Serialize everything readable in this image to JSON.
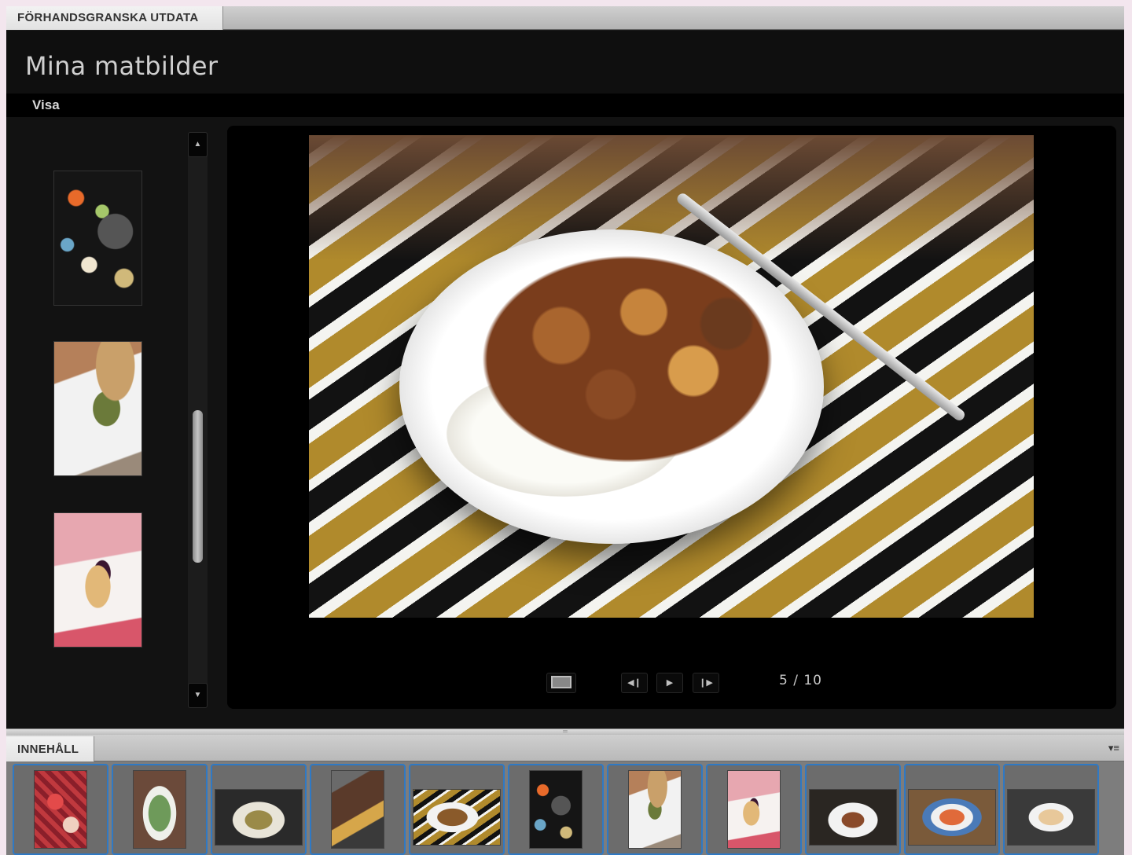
{
  "preview_tab": {
    "label": "FÖRHANDSGRANSKA UTDATA"
  },
  "gallery": {
    "title": "Mina matbilder",
    "view_label": "Visa"
  },
  "filmstrip": {
    "scroll_up_glyph": "▲",
    "scroll_down_glyph": "▼"
  },
  "viewer": {
    "counter": "5 / 10",
    "prev_glyph": "◀❙",
    "play_glyph": "▶",
    "next_glyph": "❙▶"
  },
  "content_panel": {
    "tab_label": "INNEHÅLL",
    "menu_glyph": "▾≡"
  },
  "resize_grip_glyph": "═",
  "icons": {
    "fullscreen": "fullscreen-icon",
    "prev": "previous-icon",
    "play": "play-icon",
    "next": "next-icon",
    "menu": "panel-menu-icon"
  },
  "colors": {
    "selection_border": "#2f79c4",
    "gallery_background": "#121212"
  }
}
